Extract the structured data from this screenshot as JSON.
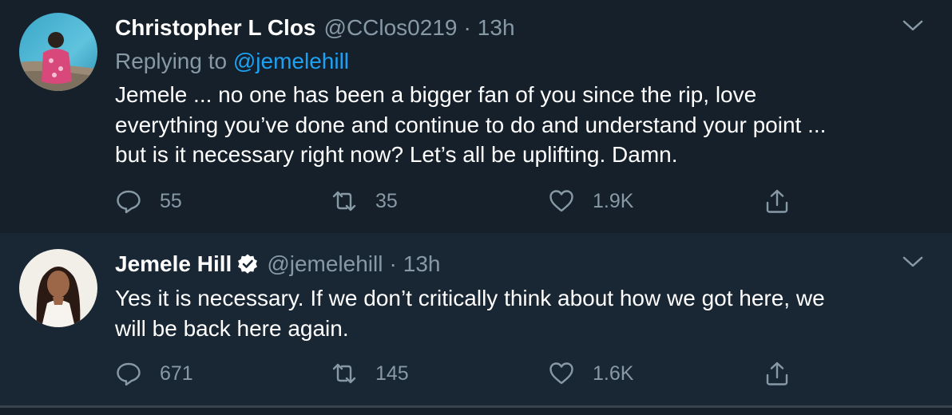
{
  "tweets": [
    {
      "display_name": "Christopher L Clos",
      "handle": "@CClos0219",
      "separator": "·",
      "time": "13h",
      "replying_prefix": "Replying to",
      "replying_to": "@jemelehill",
      "body_lines": [
        "Jemele ... no one has been a bigger fan of you since the rip, love",
        "everything you’ve done and continue to do and understand your point ...",
        "but is it necessary right now? Let’s all be uplifting. Damn."
      ],
      "replies": "55",
      "retweets": "35",
      "likes": "1.9K",
      "verified": false
    },
    {
      "display_name": "Jemele Hill",
      "handle": "@jemelehill",
      "separator": "·",
      "time": "13h",
      "body_lines": [
        "Yes it is necessary. If we don’t critically think about how we got here, we",
        "will be back here again."
      ],
      "replies": "671",
      "retweets": "145",
      "likes": "1.6K",
      "verified": true
    }
  ],
  "colors": {
    "background": "#15202b",
    "highlight_background": "#192734",
    "secondary_text": "#8899a6",
    "mention": "#1da1f2",
    "verified_badge": "#ffffff",
    "divider": "#38444d"
  },
  "icons": {
    "reply": "reply-icon",
    "retweet": "retweet-icon",
    "like": "heart-icon",
    "share": "share-icon",
    "more": "chevron-down-icon",
    "verified": "verified-badge-icon"
  }
}
